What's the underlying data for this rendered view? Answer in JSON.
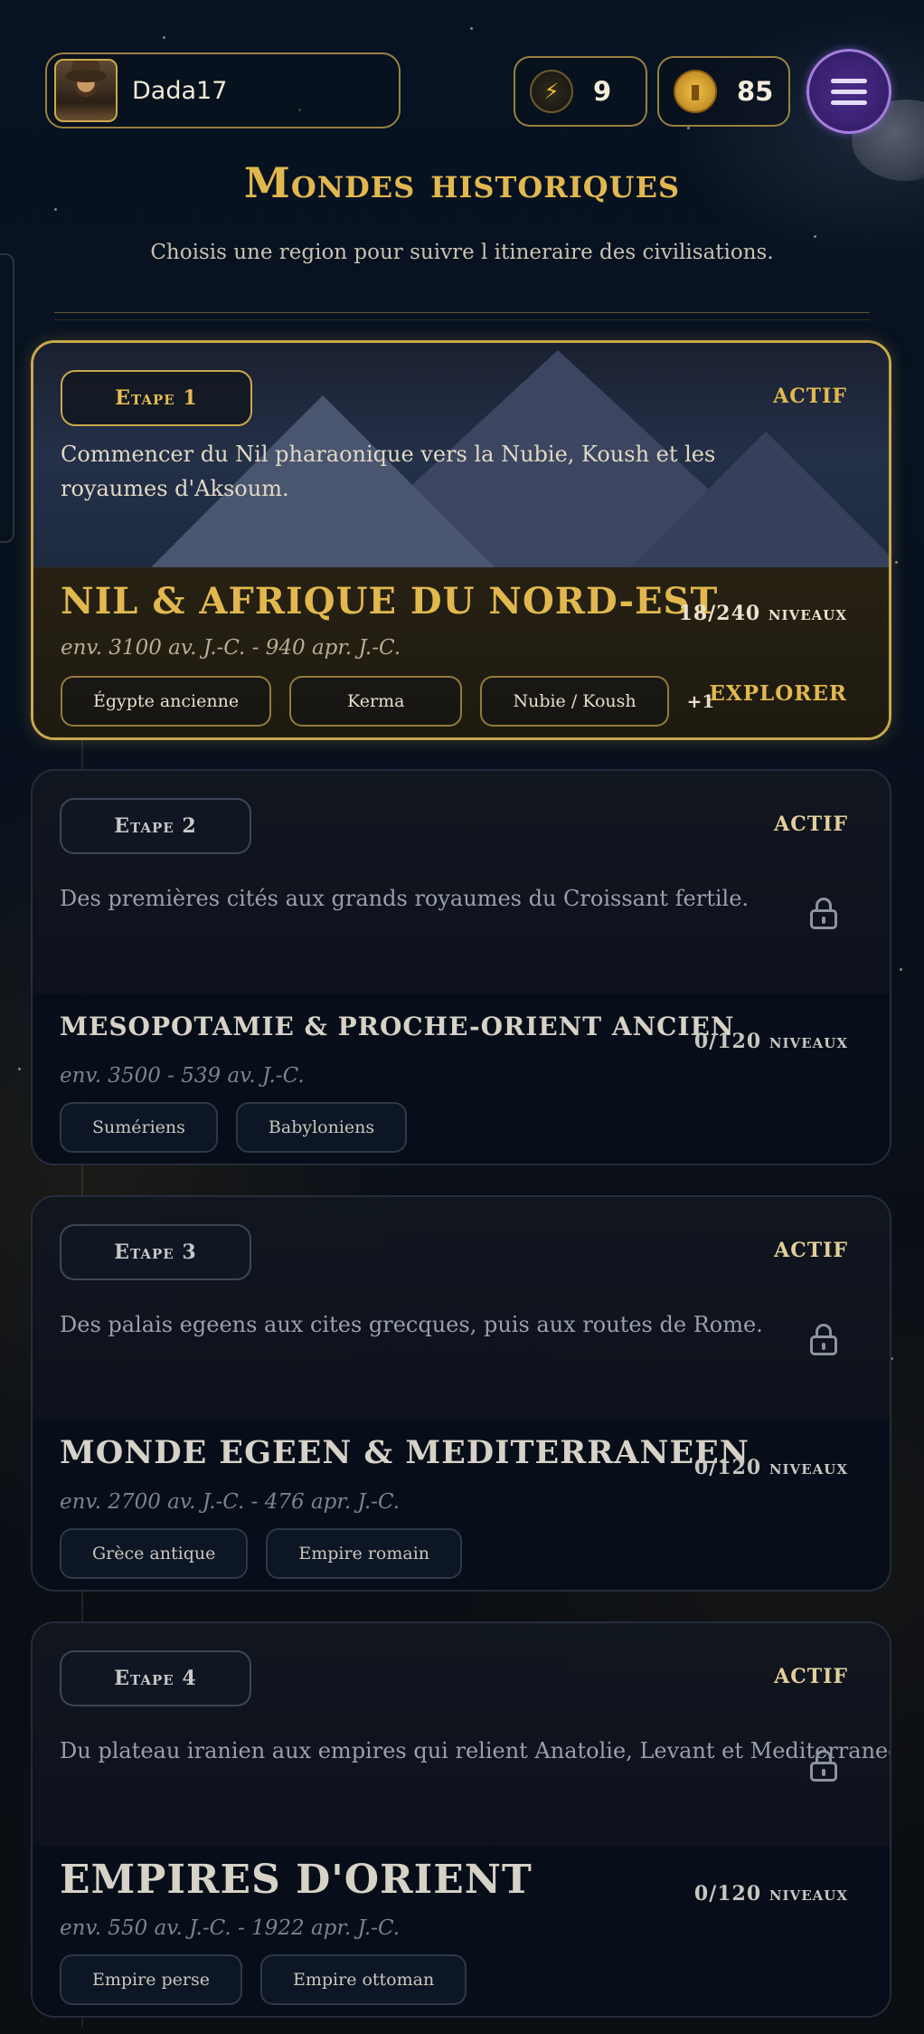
{
  "header": {
    "player_name": "Dada17",
    "energy": "9",
    "coins": "85"
  },
  "page": {
    "title": "Mondes historiques",
    "subtitle": "Choisis une region pour suivre l itineraire des civilisations."
  },
  "regions": [
    {
      "stage": "Etape 1",
      "status": "ACTIF",
      "description": "Commencer du Nil pharaonique vers la Nubie, Koush et les royaumes d'Aksoum.",
      "name": "NIL & AFRIQUE DU NORD-EST",
      "progress": "18/240 niveaux",
      "dates": "env. 3100 av. J.-C. - 940 apr. J.-C.",
      "tags": [
        "Égypte ancienne",
        "Kerma",
        "Nubie / Koush"
      ],
      "more": "+1",
      "action": "EXPLORER",
      "locked": false
    },
    {
      "stage": "Etape 2",
      "status": "ACTIF",
      "description": "Des premières cités aux grands royaumes du Croissant fertile.",
      "name": "MESOPOTAMIE & PROCHE-ORIENT ANCIEN",
      "progress": "0/120 niveaux",
      "dates": "env. 3500 - 539 av. J.-C.",
      "tags": [
        "Sumériens",
        "Babyloniens"
      ],
      "locked": true
    },
    {
      "stage": "Etape 3",
      "status": "ACTIF",
      "description": "Des palais egeens aux cites grecques, puis aux routes de Rome.",
      "name": "MONDE EGEEN & MEDITERRANEEN",
      "progress": "0/120 niveaux",
      "dates": "env. 2700 av. J.-C. - 476 apr. J.-C.",
      "tags": [
        "Grèce antique",
        "Empire romain"
      ],
      "locked": true
    },
    {
      "stage": "Etape 4",
      "status": "ACTIF",
      "description": "Du plateau iranien aux empires qui relient Anatolie, Levant et Mediterranee.",
      "name": "EMPIRES D'ORIENT",
      "progress": "0/120 niveaux",
      "dates": "env. 550 av. J.-C. - 1922 apr. J.-C.",
      "tags": [
        "Empire perse",
        "Empire ottoman"
      ],
      "locked": true
    }
  ],
  "icons": {
    "energy": "lightning-icon",
    "coins": "coin-icon",
    "menu": "hamburger-menu-icon",
    "lock": "lock-icon"
  },
  "colors": {
    "accent_gold": "#e2b84e",
    "menu_purple": "#4a2c8c",
    "background": "#06101c"
  }
}
